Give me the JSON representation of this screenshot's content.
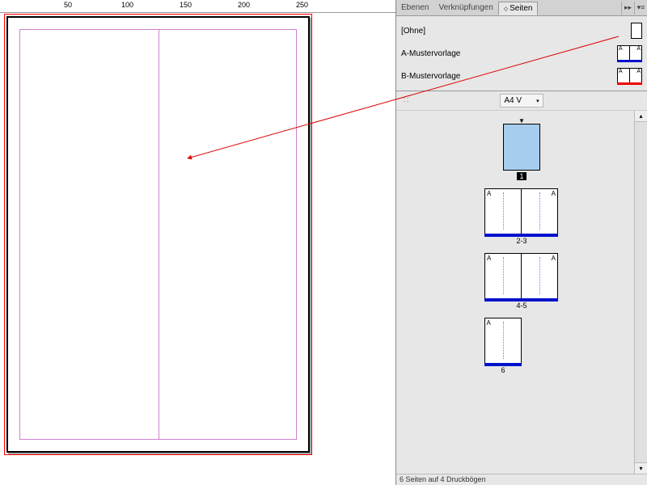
{
  "ruler": {
    "ticks": [
      "50",
      "100",
      "150",
      "200",
      "250"
    ]
  },
  "tabs": {
    "layers": "Ebenen",
    "links": "Verknüpfungen",
    "pages": "Seiten"
  },
  "collapse_glyph": "▸▸",
  "menu_glyph": "▾≡",
  "masters": [
    {
      "label": "[Ohne]",
      "type": "single",
      "bar": null,
      "letters": [
        "",
        ""
      ]
    },
    {
      "label": "A-Mustervorlage",
      "type": "spread",
      "bar": "#0011cc",
      "letters": [
        "A",
        "A"
      ]
    },
    {
      "label": "B-Mustervorlage",
      "type": "spread",
      "bar": "#ee0000",
      "letters": [
        "A",
        "A"
      ]
    }
  ],
  "toolbar_grip": "∷",
  "page_size_label": "A4 V",
  "section_marker": "▼",
  "spreads": [
    {
      "pages": [
        {
          "sel": true,
          "letters": [
            "",
            ""
          ],
          "half": true,
          "bar": false
        }
      ],
      "label": "1",
      "label_style": "inv"
    },
    {
      "pages": [
        {
          "letters": [
            "A",
            ""
          ],
          "bar": true
        },
        {
          "letters": [
            "",
            "A"
          ],
          "bar": true
        }
      ],
      "label": "2-3"
    },
    {
      "pages": [
        {
          "letters": [
            "A",
            ""
          ],
          "bar": true
        },
        {
          "letters": [
            "",
            "A"
          ],
          "bar": true
        }
      ],
      "label": "4-5"
    },
    {
      "pages": [
        {
          "letters": [
            "A",
            ""
          ],
          "bar": true,
          "half": true
        }
      ],
      "label": "6"
    }
  ],
  "scroll_up": "▴",
  "scroll_down": "▾",
  "footer": "6 Seiten auf 4 Druckbögen"
}
